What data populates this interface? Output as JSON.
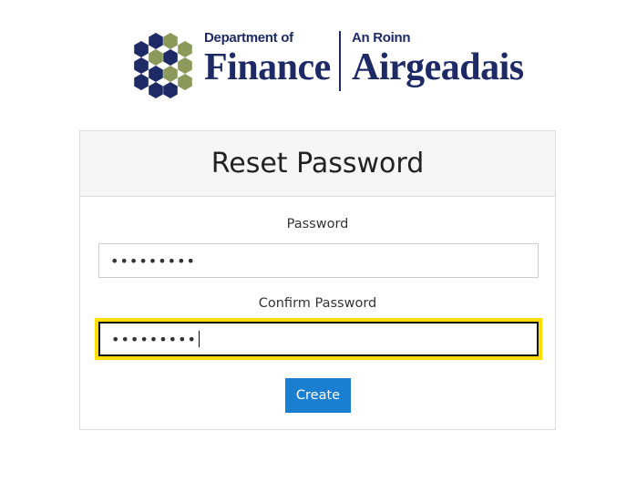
{
  "logo": {
    "english_small": "Department of",
    "english_big": "Finance",
    "irish_small": "An Roinn",
    "irish_big": "Airgeadais",
    "colors": {
      "navy": "#1d2a66",
      "olive": "#8b9a5b"
    }
  },
  "form": {
    "title": "Reset Password",
    "password_label": "Password",
    "password_value": "•••••••••",
    "confirm_label": "Confirm Password",
    "confirm_value": "•••••••••",
    "submit_label": "Create",
    "accent_color": "#1a7fd1",
    "focus_color": "#ffdd00"
  }
}
